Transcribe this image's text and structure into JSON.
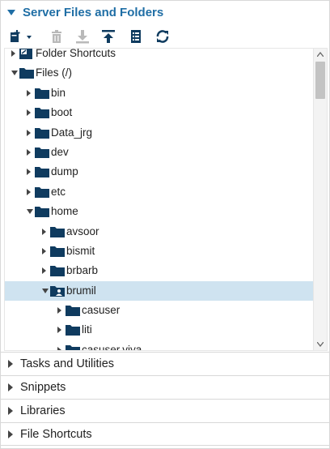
{
  "panel": {
    "title": "Server Files and Folders"
  },
  "toolbar": {
    "buttons": [
      {
        "icon": "new-icon",
        "enabled": true
      },
      {
        "icon": "delete-icon",
        "enabled": false
      },
      {
        "icon": "download-icon",
        "enabled": false
      },
      {
        "icon": "upload-icon",
        "enabled": true
      },
      {
        "icon": "properties-icon",
        "enabled": true
      },
      {
        "icon": "refresh-icon",
        "enabled": true
      }
    ]
  },
  "tree": {
    "rows": [
      {
        "label": "Folder Shortcuts",
        "depth": 0,
        "state": "closed",
        "icon": "shortcut-icon"
      },
      {
        "label": "Files (/)",
        "depth": 0,
        "state": "open",
        "icon": "folder-icon"
      },
      {
        "label": "bin",
        "depth": 1,
        "state": "closed",
        "icon": "folder-icon"
      },
      {
        "label": "boot",
        "depth": 1,
        "state": "closed",
        "icon": "folder-icon"
      },
      {
        "label": "Data_jrg",
        "depth": 1,
        "state": "closed",
        "icon": "folder-icon"
      },
      {
        "label": "dev",
        "depth": 1,
        "state": "closed",
        "icon": "folder-icon"
      },
      {
        "label": "dump",
        "depth": 1,
        "state": "closed",
        "icon": "folder-icon"
      },
      {
        "label": "etc",
        "depth": 1,
        "state": "closed",
        "icon": "folder-icon"
      },
      {
        "label": "home",
        "depth": 1,
        "state": "open",
        "icon": "folder-icon"
      },
      {
        "label": "avsoor",
        "depth": 2,
        "state": "closed",
        "icon": "folder-icon"
      },
      {
        "label": "bismit",
        "depth": 2,
        "state": "closed",
        "icon": "folder-icon"
      },
      {
        "label": "brbarb",
        "depth": 2,
        "state": "closed",
        "icon": "folder-icon"
      },
      {
        "label": "brumil",
        "depth": 2,
        "state": "open",
        "icon": "home-folder-icon",
        "selected": true
      },
      {
        "label": "casuser",
        "depth": 3,
        "state": "closed",
        "icon": "folder-icon"
      },
      {
        "label": "liti",
        "depth": 3,
        "state": "closed",
        "icon": "folder-icon"
      },
      {
        "label": "casuser.viya",
        "depth": 3,
        "state": "closed",
        "icon": "folder-icon"
      }
    ]
  },
  "sections": [
    {
      "title": "Tasks and Utilities"
    },
    {
      "title": "Snippets"
    },
    {
      "title": "Libraries"
    },
    {
      "title": "File Shortcuts"
    }
  ],
  "colors": {
    "accent": "#1f6ea5",
    "folder": "#0f3b5f",
    "selected_row": "#cfe3f0",
    "disabled_icon": "#b9b9b9"
  }
}
